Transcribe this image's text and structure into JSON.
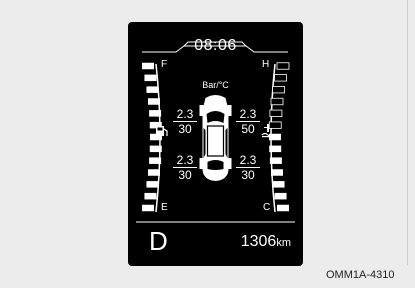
{
  "cluster": {
    "clock": "08:06",
    "unit": "Bar/°C",
    "fuel_full_label": "F",
    "fuel_empty_label": "E",
    "temp_hot_label": "H",
    "temp_cold_label": "C",
    "gear": "D",
    "odometer_value": "1306",
    "odometer_unit": "km",
    "fuel_icon": "fuel-pump-icon",
    "temp_icon": "coolant-thermometer-icon",
    "fuel_level": 1.0,
    "temp_level": 0.5
  },
  "tires": {
    "front_left": {
      "pressure": "2.3",
      "temp": "30"
    },
    "front_right": {
      "pressure": "2.3",
      "temp": "50"
    },
    "rear_left": {
      "pressure": "2.3",
      "temp": "30"
    },
    "rear_right": {
      "pressure": "2.3",
      "temp": "30"
    }
  },
  "caption": "OMM1A-4310"
}
